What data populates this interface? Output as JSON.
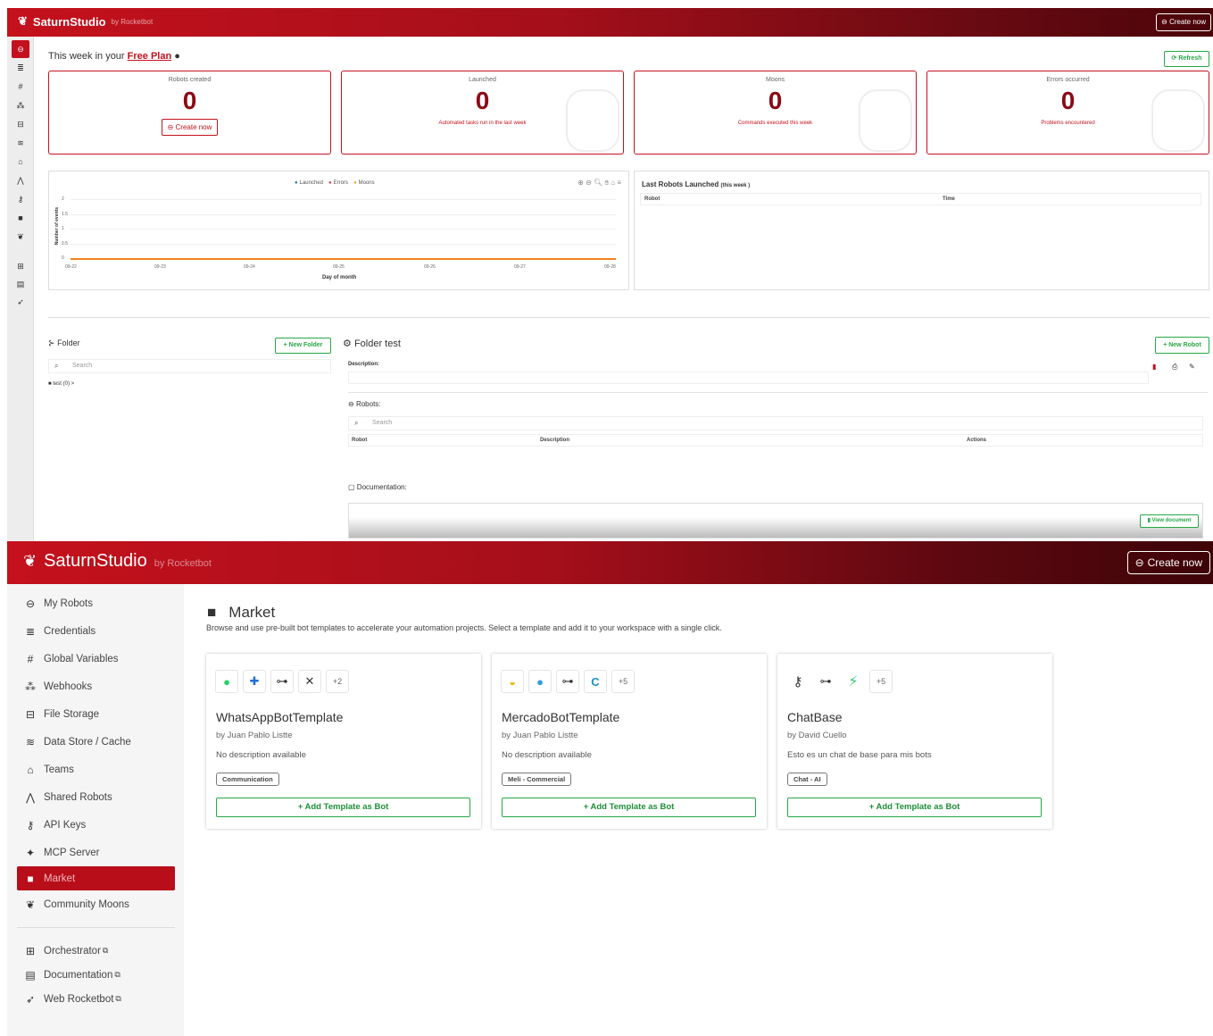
{
  "top": {
    "brand": "SaturnStudio",
    "brand_by": "by Rocketbot",
    "create_label": "Create now",
    "week_prefix": "This week in your",
    "plan": "Free Plan",
    "refresh_label": "Refresh",
    "cards": [
      {
        "label": "Robots created",
        "value": "0",
        "button": "Create now",
        "sub": ""
      },
      {
        "label": "Launched",
        "value": "0",
        "sub": "Automated tasks run in the last week"
      },
      {
        "label": "Moons",
        "value": "0",
        "sub": "Commands executed this week"
      },
      {
        "label": "Errors occurred",
        "value": "0",
        "sub": "Problems encountered"
      }
    ],
    "chart_legend": [
      "Launched",
      "Errors",
      "Moons"
    ],
    "last_title": "Last Robots Launched",
    "last_title_small": "(this week )",
    "last_cols": [
      "Robot",
      "Time"
    ],
    "folder_title": "Folder",
    "new_folder": "+ New Folder",
    "search_placeholder": "Search",
    "folder_item": "test (0)",
    "folder_test_title": "Folder test",
    "new_robot": "+ New Robot",
    "description_label": "Description:",
    "robots_label": "Robots:",
    "robot_cols": [
      "Robot",
      "Description",
      "Actions"
    ],
    "documentation_label": "Documentation:",
    "view_document": "View document"
  },
  "chart_data": {
    "type": "line",
    "x": [
      "09-22",
      "09-23",
      "09-24",
      "09-25",
      "09-26",
      "09-27",
      "09-28"
    ],
    "series": [
      {
        "name": "Launched",
        "values": [
          0,
          0,
          0,
          0,
          0,
          0,
          0
        ],
        "color": "#1f77b4"
      },
      {
        "name": "Errors",
        "values": [
          0,
          0,
          0,
          0,
          0,
          0,
          0
        ],
        "color": "#e8314a"
      },
      {
        "name": "Moons",
        "values": [
          0,
          0,
          0,
          0,
          0,
          0,
          0
        ],
        "color": "#f5821f"
      }
    ],
    "yticks": [
      "2",
      "1.5",
      "1",
      "0.5",
      "0"
    ],
    "xlabel": "Day of month",
    "ylabel": "Number of events",
    "ylim": [
      0,
      2
    ]
  },
  "header": {
    "brand": "SaturnStudio",
    "brand_by": "by Rocketbot",
    "create_label": "Create now"
  },
  "sidebar": {
    "items": [
      {
        "label": "My Robots",
        "icon": "robot-icon"
      },
      {
        "label": "Credentials",
        "icon": "credentials-icon"
      },
      {
        "label": "Global Variables",
        "icon": "hash-icon"
      },
      {
        "label": "Webhooks",
        "icon": "webhooks-icon"
      },
      {
        "label": "File Storage",
        "icon": "storage-icon"
      },
      {
        "label": "Data Store / Cache",
        "icon": "database-icon"
      },
      {
        "label": "Teams",
        "icon": "teams-icon"
      },
      {
        "label": "Shared Robots",
        "icon": "share-icon"
      },
      {
        "label": "API Keys",
        "icon": "key-icon"
      },
      {
        "label": "MCP Server",
        "icon": "mcp-icon"
      },
      {
        "label": "Market",
        "icon": "market-icon"
      },
      {
        "label": "Community Moons",
        "icon": "moons-icon"
      }
    ],
    "external": [
      {
        "label": "Orchestrator",
        "icon": "orchestrator-icon"
      },
      {
        "label": "Documentation",
        "icon": "book-icon"
      },
      {
        "label": "Web Rocketbot",
        "icon": "rocket-icon"
      }
    ]
  },
  "market": {
    "title": "Market",
    "description": "Browse and use pre-built bot templates to accelerate your automation projects. Select a template and add it to your workspace with a single click.",
    "templates": [
      {
        "name": "WhatsAppBotTemplate",
        "author": "by Juan Pablo Listte",
        "description": "No description available",
        "tag": "Communication",
        "more": "+2",
        "button": "+ Add Template as Bot"
      },
      {
        "name": "MercadoBotTemplate",
        "author": "by Juan Pablo Listte",
        "description": "No description available",
        "tag": "Meli - Commercial",
        "more": "+5",
        "button": "+ Add Template as Bot"
      },
      {
        "name": "ChatBase",
        "author": "by David Cuello",
        "description": "Esto es un chat de base para mis bots",
        "tag": "Chat - AI",
        "more": "+5",
        "button": "+ Add Template as Bot"
      }
    ]
  },
  "colors": {
    "brand_red": "#c4111d",
    "green": "#28a745",
    "orange": "#f5821f"
  }
}
